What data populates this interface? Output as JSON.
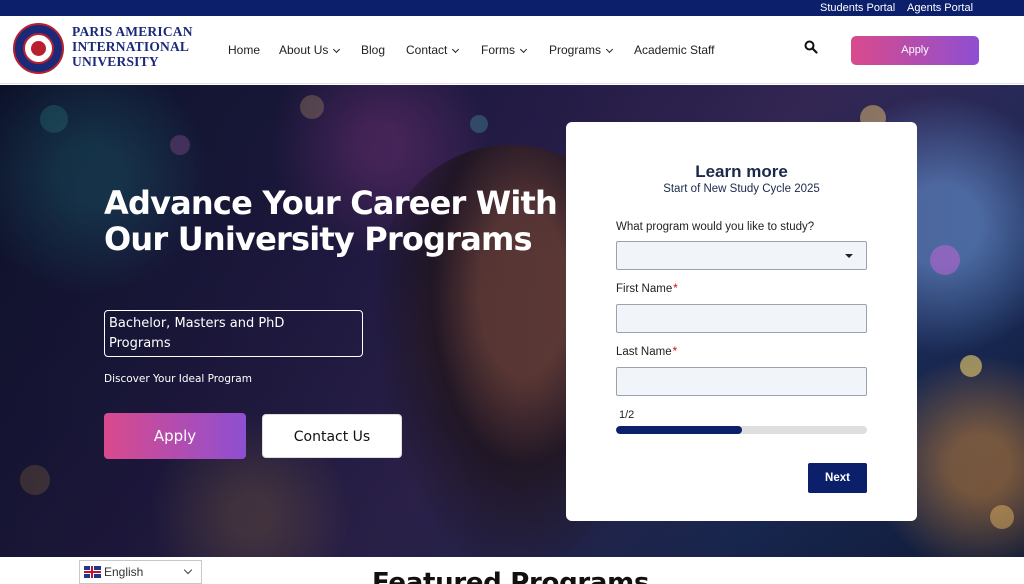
{
  "topbar": {
    "students_portal": "Students Portal",
    "agents_portal": "Agents Portal"
  },
  "header": {
    "logo_lines": [
      "PARIS AMERICAN",
      "INTERNATIONAL",
      "UNIVERSITY"
    ],
    "nav": [
      {
        "label": "Home",
        "has_dropdown": false
      },
      {
        "label": "About Us",
        "has_dropdown": true
      },
      {
        "label": "Blog",
        "has_dropdown": false
      },
      {
        "label": "Contact",
        "has_dropdown": true
      },
      {
        "label": "Forms",
        "has_dropdown": true
      },
      {
        "label": "Programs",
        "has_dropdown": true
      },
      {
        "label": "Academic Staff",
        "has_dropdown": false
      }
    ],
    "search_icon": "search-icon",
    "apply_label": "Apply"
  },
  "hero": {
    "title_lines": [
      "Advance Your Career With",
      "Our University Programs"
    ],
    "programs_box_lines": [
      "Bachelor, Masters and PhD",
      "Programs"
    ],
    "subtitle": "Discover Your Ideal Program",
    "apply_label": "Apply",
    "contact_label": "Contact Us"
  },
  "form": {
    "title": "Learn more",
    "subtitle": "Start of New Study Cycle 2025",
    "program_label": "What program would you like to study?",
    "program_value": "",
    "first_name_label": "First Name",
    "first_name_value": "",
    "last_name_label": "Last Name",
    "last_name_value": "",
    "required_mark": "*",
    "step_text": "1/2",
    "progress": 0.5,
    "next_label": "Next"
  },
  "language": {
    "label": "English",
    "flag_icon": "uk-flag-icon"
  },
  "featured": {
    "heading": "Featured Programs"
  },
  "colors": {
    "navy": "#0b1f6b",
    "gradient_start": "#d94a8c",
    "gradient_end": "#8e4fd1",
    "required": "#d0021b"
  }
}
